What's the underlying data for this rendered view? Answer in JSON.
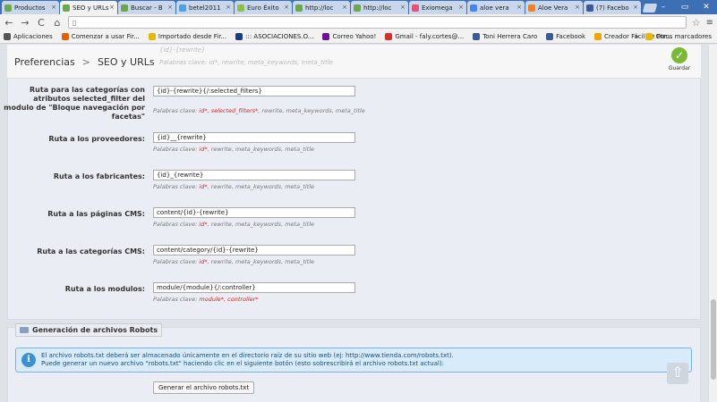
{
  "tabs": [
    {
      "label": "Productos",
      "color": "#6aa84f"
    },
    {
      "label": "SEO y URLs",
      "color": "#6aa84f",
      "active": true
    },
    {
      "label": "Buscar - B",
      "color": "#6aa84f"
    },
    {
      "label": "betel2011",
      "color": "#4aa3df"
    },
    {
      "label": "Euro Éxito",
      "color": "#8bc34a"
    },
    {
      "label": "http://loc",
      "color": "#6aa84f"
    },
    {
      "label": "http://loc",
      "color": "#6aa84f"
    },
    {
      "label": "Exiomega",
      "color": "#e94e77"
    },
    {
      "label": "aloe vera",
      "color": "#4285f4"
    },
    {
      "label": "Aloe Vera",
      "color": "#f4811f"
    },
    {
      "label": "(7) Facebo",
      "color": "#3b5998"
    }
  ],
  "toolbar": {
    "back": "←",
    "forward": "→",
    "reload": "C",
    "home": "⌂",
    "url": "",
    "star": "☆",
    "menu": "≡"
  },
  "bookmarks": [
    {
      "label": "Aplicaciones",
      "color": "#555"
    },
    {
      "label": "Comenzar a usar Fir...",
      "color": "#e66000"
    },
    {
      "label": "Importado desde Fir...",
      "color": "#e6b800"
    },
    {
      "label": "::: ASOCIACIONES.O...",
      "color": "#1a3b8c"
    },
    {
      "label": "Correo Yahoo!",
      "color": "#720e9e"
    },
    {
      "label": "Gmail - faly.cortes@...",
      "color": "#d93025"
    },
    {
      "label": "Toni Herrera Caro",
      "color": "#3b5998"
    },
    {
      "label": "Facebook",
      "color": "#3b5998"
    },
    {
      "label": "Creador Fácil de For...",
      "color": "#f4a300"
    }
  ],
  "bookmarks_more": "»",
  "bookmarks_other": "Otros marcadores",
  "header": {
    "crumb1": "Preferencias",
    "sep": ">",
    "crumb2": "SEO y URLs",
    "save_label": "Guardar",
    "ghost1": "{id}-{rewrite}",
    "ghost2": "Palabras clave: id*, rewrite, meta_keywords, meta_title"
  },
  "keywords_prefix": "Palabras clave:",
  "routes": [
    {
      "label": "Ruta para las categorías con atributos selected_filter del modulo de \"Bloque navegación por facetas\"",
      "value": "{id}-{rewrite}{/:selected_filters}",
      "required": "id*, selected_filters*",
      "optional": ", rewrite, meta_keywords, meta_title"
    },
    {
      "label": "Ruta a los proveedores:",
      "value": "{id}__{rewrite}",
      "required": "id*",
      "optional": ", rewrite, meta_keywords, meta_title"
    },
    {
      "label": "Ruta a los fabricantes:",
      "value": "{id}_{rewrite}",
      "required": "id*",
      "optional": ", rewrite, meta_keywords, meta_title"
    },
    {
      "label": "Ruta a las páginas CMS:",
      "value": "content/{id}-{rewrite}",
      "required": "id*",
      "optional": ", rewrite, meta_keywords, meta_title"
    },
    {
      "label": "Ruta a las categorías CMS:",
      "value": "content/category/{id}-{rewrite}",
      "required": "id*",
      "optional": ", rewrite, meta_keywords, meta_title"
    },
    {
      "label": "Ruta a los modulos:",
      "value": "module/{module}{/:controller}",
      "required": "module*, controller*",
      "optional": ""
    }
  ],
  "robots": {
    "legend": "Generación de archivos Robots",
    "info_line1": "El archivo robots.txt deberá ser almacenado únicamente en el directorio raíz de su sitio web (ej: http://www.tienda.com/robots.txt).",
    "info_line2": "Puede generar un nuevo archivo \"robots.txt\" haciendo clic en el siguiente botón (esto sobrescribirá el archivo robots.txt actual):",
    "button": "Generar el archivo robots.txt"
  }
}
